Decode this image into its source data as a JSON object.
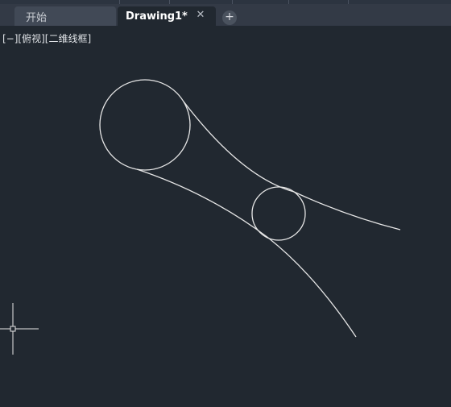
{
  "tabs": {
    "start_label": "开始",
    "drawing_label": "Drawing1*",
    "close_glyph": "✕",
    "add_glyph": "+"
  },
  "viewport": {
    "view_control": "[−]",
    "view_name": "[俯视]",
    "visual_style": "[二维线框]"
  },
  "colors": {
    "background": "#212830",
    "geometry": "#e6e6e6"
  }
}
